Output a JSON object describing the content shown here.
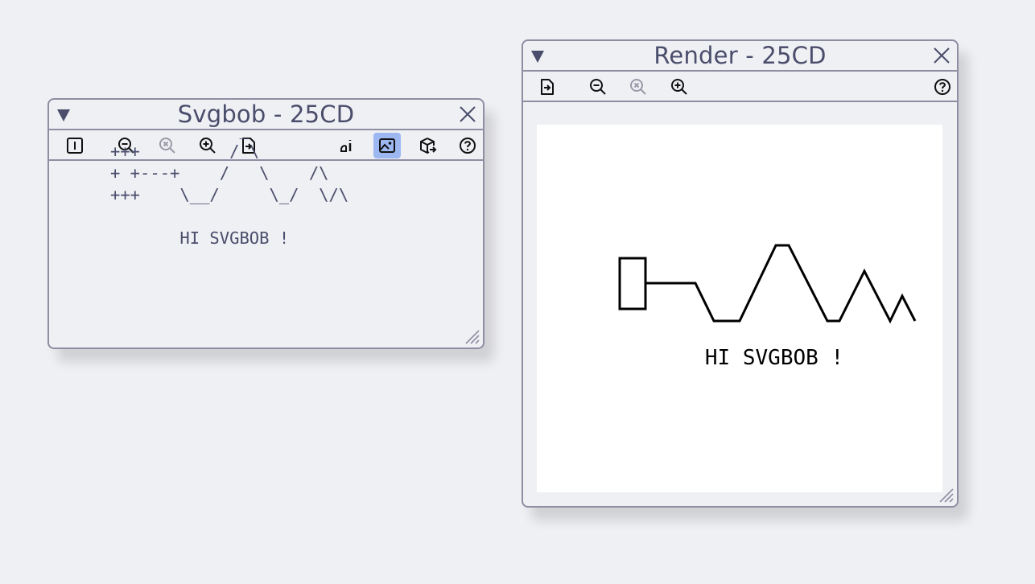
{
  "editor_window": {
    "title": "Svgbob - 25CD",
    "ascii_art": "             _\n+++         / \\\n+ +---+    /   \\    /\\\n+++    \\__/     \\_/  \\/\\\n\n       HI SVGBOB !",
    "toolbar_icons": [
      "text-cursor-icon",
      "zoom-out-icon",
      "zoom-reset-icon",
      "zoom-in-icon",
      "export-icon",
      "ascii-mode-icon",
      "image-preview-icon",
      "package-export-icon",
      "help-icon"
    ],
    "active_tool": "image-preview-icon"
  },
  "render_window": {
    "title": "Render - 25CD",
    "rendered_text": "HI SVGBOB !",
    "toolbar_icons": [
      "export-icon",
      "zoom-out-icon",
      "zoom-reset-icon",
      "zoom-in-icon",
      "help-icon"
    ]
  },
  "colors": {
    "background": "#eff0f4",
    "border": "#8e8ea3",
    "text": "#4a4d6b",
    "active_button": "#9db8f1",
    "canvas": "#ffffff"
  }
}
